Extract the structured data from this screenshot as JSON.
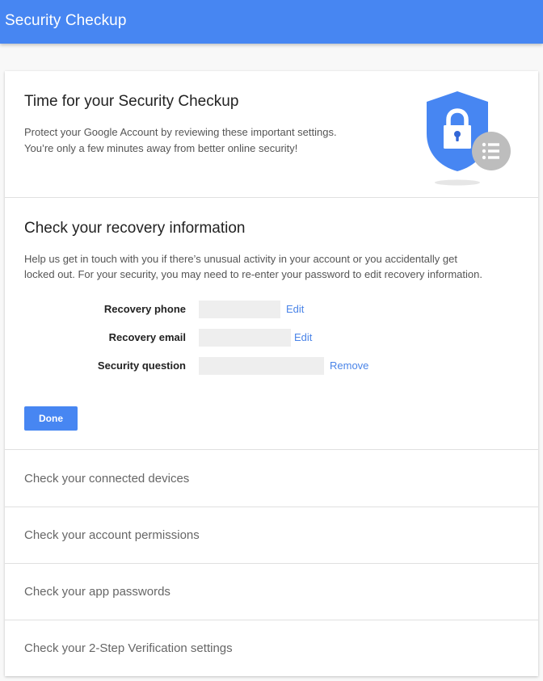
{
  "appbar": {
    "title": "Security Checkup",
    "color": "#4786f2"
  },
  "intro": {
    "title": "Time for your Security Checkup",
    "text_line1": "Protect your Google Account by reviewing these important settings.",
    "text_line2": "You’re only a few minutes away from better online security!",
    "illustration": {
      "shield_icon": "shield-lock-icon",
      "badge_icon": "list-icon",
      "shield_color": "#4786f2",
      "badge_color": "#bdbdbd"
    }
  },
  "recovery": {
    "title": "Check your recovery information",
    "text_line1": "Help us get in touch with you if there’s unusual activity in your account or you accidentally get",
    "text_line2": "locked out. For your security, you may need to re-enter your password to edit recovery information.",
    "fields": [
      {
        "label": "Recovery phone",
        "value": "",
        "action": "Edit"
      },
      {
        "label": "Recovery email",
        "value": "",
        "action": "Edit"
      },
      {
        "label": "Security question",
        "value": "",
        "action": "Remove"
      }
    ],
    "done_label": "Done"
  },
  "sections": [
    {
      "label": "Check your connected devices"
    },
    {
      "label": "Check your account permissions"
    },
    {
      "label": "Check your app passwords"
    },
    {
      "label": "Check your 2-Step Verification settings"
    }
  ],
  "colors": {
    "link": "#4a84e8",
    "button": "#4786f2"
  }
}
